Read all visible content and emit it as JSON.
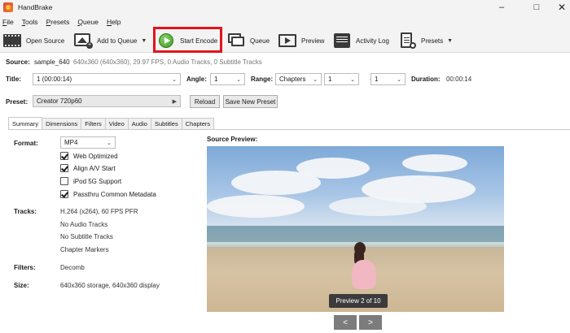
{
  "window": {
    "title": "HandBrake"
  },
  "menu": [
    "File",
    "Tools",
    "Presets",
    "Queue",
    "Help"
  ],
  "toolbar": {
    "open_source": "Open Source",
    "add_to_queue": "Add to Queue",
    "start_encode": "Start Encode",
    "queue": "Queue",
    "preview": "Preview",
    "activity_log": "Activity Log",
    "presets": "Presets"
  },
  "source": {
    "label": "Source:",
    "name": "sample_640",
    "details": "640x360 (640x360), 29.97 FPS, 0 Audio Tracks, 0 Subtitle Tracks"
  },
  "title_row": {
    "title_label": "Title:",
    "title_value": "1  (00:00:14)",
    "angle_label": "Angle:",
    "angle_value": "1",
    "range_label": "Range:",
    "range_type": "Chapters",
    "range_start": "1",
    "range_dash": "-",
    "range_end": "1",
    "duration_label": "Duration:",
    "duration_value": "00:00:14"
  },
  "preset_row": {
    "label": "Preset:",
    "value": "Creator 720p60",
    "reload": "Reload",
    "save_new": "Save New Preset"
  },
  "tabs": [
    "Summary",
    "Dimensions",
    "Filters",
    "Video",
    "Audio",
    "Subtitles",
    "Chapters"
  ],
  "summary": {
    "format_label": "Format:",
    "format_value": "MP4",
    "options": [
      {
        "label": "Web Optimized",
        "checked": true
      },
      {
        "label": "Align A/V Start",
        "checked": true
      },
      {
        "label": "iPod 5G Support",
        "checked": false
      },
      {
        "label": "Passthru Common Metadata",
        "checked": true
      }
    ],
    "tracks_label": "Tracks:",
    "tracks": [
      "H.264 (x264), 60 FPS PFR",
      "No Audio Tracks",
      "No Subtitle Tracks",
      "Chapter Markers"
    ],
    "filters_label": "Filters:",
    "filters_value": "Decomb",
    "size_label": "Size:",
    "size_value": "640x360 storage, 640x360 display"
  },
  "preview": {
    "label": "Source Preview:",
    "counter": "Preview 2 of 10",
    "prev": "<",
    "next": ">"
  }
}
